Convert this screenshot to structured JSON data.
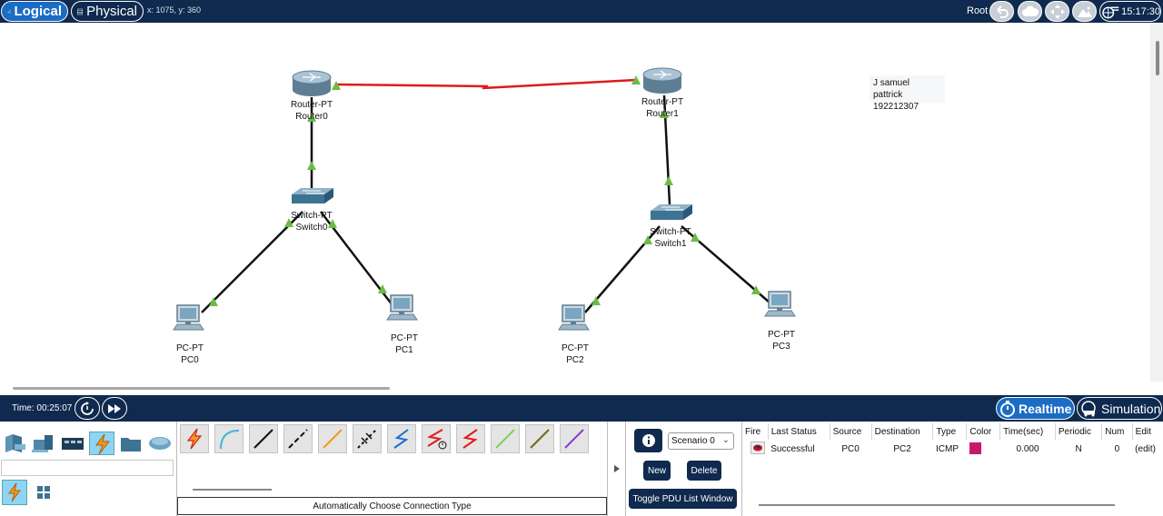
{
  "topbar": {
    "logical_label": "Logical",
    "physical_label": "Physical",
    "coords": "x: 1075, y: 360",
    "root_label": "Root",
    "clock": "15:17:30",
    "icons": [
      "back-icon",
      "cloud-icon",
      "move-icon",
      "mountain-icon",
      "viewport-icon"
    ]
  },
  "devices": [
    {
      "id": "router0",
      "type": "Router-PT",
      "name": "Router0"
    },
    {
      "id": "router1",
      "type": "Router-PT",
      "name": "Router1"
    },
    {
      "id": "switch0",
      "type": "Switch-PT",
      "name": "Switch0"
    },
    {
      "id": "switch1",
      "type": "Switch-PT",
      "name": "Switch1"
    },
    {
      "id": "pc0",
      "type": "PC-PT",
      "name": "PC0"
    },
    {
      "id": "pc1",
      "type": "PC-PT",
      "name": "PC1"
    },
    {
      "id": "pc2",
      "type": "PC-PT",
      "name": "PC2"
    },
    {
      "id": "pc3",
      "type": "PC-PT",
      "name": "PC3"
    }
  ],
  "links": [
    {
      "from": "router0",
      "to": "router1",
      "type": "serial",
      "color": "#e01b1b"
    },
    {
      "from": "router0",
      "to": "switch0",
      "type": "straight",
      "color": "#111111"
    },
    {
      "from": "router1",
      "to": "switch1",
      "type": "straight",
      "color": "#111111"
    },
    {
      "from": "switch0",
      "to": "pc0",
      "type": "straight",
      "color": "#111111"
    },
    {
      "from": "switch0",
      "to": "pc1",
      "type": "straight",
      "color": "#111111"
    },
    {
      "from": "switch1",
      "to": "pc2",
      "type": "straight",
      "color": "#111111"
    },
    {
      "from": "switch1",
      "to": "pc3",
      "type": "straight",
      "color": "#111111"
    }
  ],
  "link_status_color": "#6dbb45",
  "note": {
    "line1": "J samuel pattrick",
    "line2": "192212307"
  },
  "timebar": {
    "time": "Time: 00:25:07",
    "realtime_label": "Realtime",
    "simulation_label": "Simulation"
  },
  "device_categories": [
    "network-devices-icon",
    "end-devices-icon",
    "components-icon",
    "connections-icon",
    "miscellaneous-icon",
    "multiuser-icon"
  ],
  "connections": {
    "status": "Automatically Choose Connection Type",
    "types": [
      "automatic",
      "console",
      "copper-straight-through",
      "copper-cross-over",
      "fiber",
      "phone",
      "coaxial",
      "serial-dce",
      "serial-dte",
      "octal",
      "iot-custom",
      "usb"
    ]
  },
  "scenario": {
    "selected": "Scenario 0",
    "new_label": "New",
    "delete_label": "Delete",
    "toggle_label": "Toggle PDU List Window"
  },
  "pdu_table": {
    "headers": [
      "Fire",
      "Last Status",
      "Source",
      "Destination",
      "Type",
      "Color",
      "Time(sec)",
      "Periodic",
      "Num",
      "Edit"
    ],
    "rows": [
      {
        "last_status": "Successful",
        "source": "PC0",
        "destination": "PC2",
        "type": "ICMP",
        "color": "#c8186e",
        "time": "0.000",
        "periodic": "N",
        "num": "0",
        "edit": "(edit)"
      }
    ]
  }
}
